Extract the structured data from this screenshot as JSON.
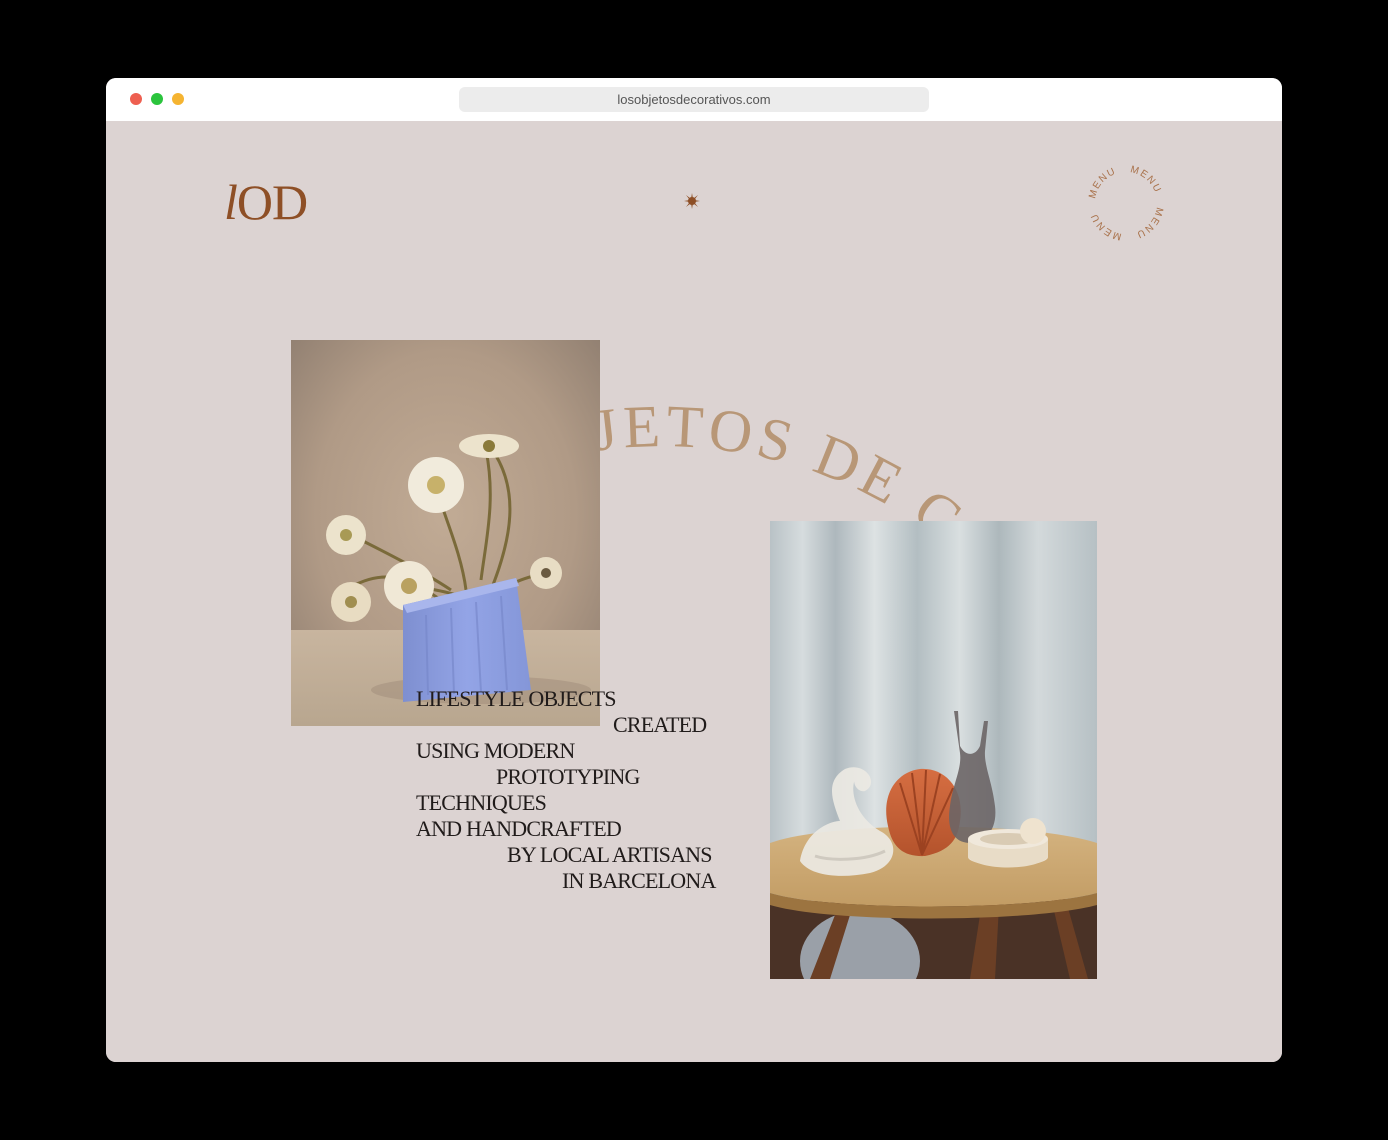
{
  "browser": {
    "url": "losobjetosdecorativos.com"
  },
  "header": {
    "logo": {
      "first": "l",
      "rest": "OD"
    },
    "menu_word": "MENU"
  },
  "hero": {
    "arc_text": "JETOS DE C",
    "tagline": [
      "LIFESTYLE OBJECTS",
      "CREATED",
      "USING MODERN",
      "PROTOTYPING",
      "TECHNIQUES",
      "AND HANDCRAFTED",
      "BY LOCAL ARTISANS",
      "IN BARCELONA"
    ]
  },
  "icons": {
    "star": "sparkle-icon",
    "menu": "circular-menu-icon"
  },
  "colors": {
    "background": "#dcd3d2",
    "brand": "#8e4f26",
    "arc_text": "#b89777",
    "text": "#201b1a"
  }
}
